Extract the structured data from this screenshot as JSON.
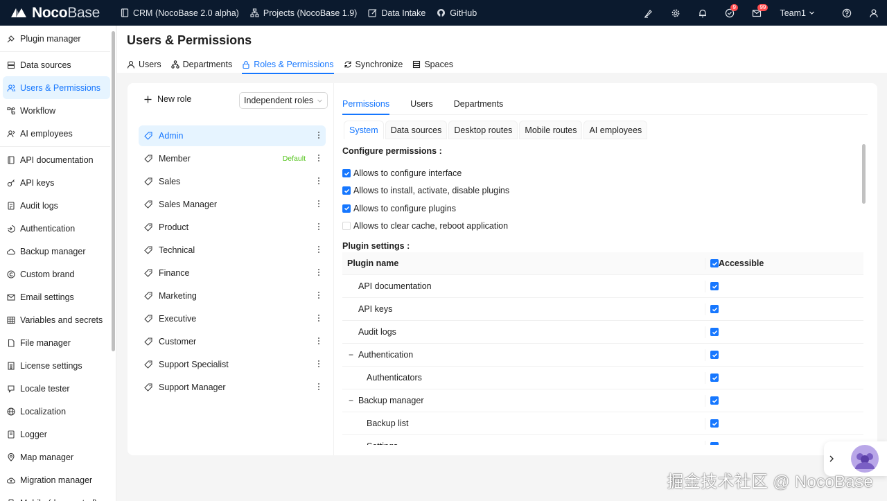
{
  "topbar": {
    "logo_bold": "Noco",
    "logo_thin": "Base",
    "nav": [
      {
        "label": "CRM (NocoBase 2.0 alpha)",
        "icon": "book-icon"
      },
      {
        "label": "Projects (NocoBase 1.9)",
        "icon": "sitemap-icon"
      },
      {
        "label": "Data Intake",
        "icon": "edit-icon"
      },
      {
        "label": "GitHub",
        "icon": "github-icon"
      }
    ],
    "right_icons": [
      "highlighter-icon",
      "gear-icon",
      "bell-icon",
      "check-circle-icon",
      "mail-icon"
    ],
    "badge_tasks": "9",
    "badge_mail": "99",
    "team": "Team1"
  },
  "sidebar": {
    "items": [
      {
        "label": "Plugin manager",
        "icon": "plug-icon"
      },
      {
        "label": "Data sources",
        "icon": "database-icon"
      },
      {
        "label": "Users & Permissions",
        "icon": "users-icon",
        "active": true
      },
      {
        "label": "Workflow",
        "icon": "workflow-icon"
      },
      {
        "label": "AI employees",
        "icon": "robot-user-icon"
      },
      {
        "label": "API documentation",
        "icon": "doc-icon"
      },
      {
        "label": "API keys",
        "icon": "key-icon"
      },
      {
        "label": "Audit logs",
        "icon": "audit-icon"
      },
      {
        "label": "Authentication",
        "icon": "login-icon"
      },
      {
        "label": "Backup manager",
        "icon": "cloud-icon"
      },
      {
        "label": "Custom brand",
        "icon": "copyright-icon"
      },
      {
        "label": "Email settings",
        "icon": "mail-icon"
      },
      {
        "label": "Variables and secrets",
        "icon": "table-icon"
      },
      {
        "label": "File manager",
        "icon": "file-icon"
      },
      {
        "label": "License settings",
        "icon": "license-icon"
      },
      {
        "label": "Locale tester",
        "icon": "locale-icon"
      },
      {
        "label": "Localization",
        "icon": "globe-icon"
      },
      {
        "label": "Logger",
        "icon": "logger-icon"
      },
      {
        "label": "Map manager",
        "icon": "pin-icon"
      },
      {
        "label": "Migration manager",
        "icon": "migration-icon"
      },
      {
        "label": "Mobile (deprecated)",
        "icon": "mobile-icon"
      }
    ]
  },
  "header": {
    "title": "Users & Permissions",
    "tabs": [
      {
        "label": "Users",
        "icon": "user-icon"
      },
      {
        "label": "Departments",
        "icon": "departments-icon"
      },
      {
        "label": "Roles & Permissions",
        "icon": "lock-icon",
        "active": true
      },
      {
        "label": "Synchronize",
        "icon": "sync-icon"
      },
      {
        "label": "Spaces",
        "icon": "spaces-icon"
      }
    ]
  },
  "roles_panel": {
    "new_role": "New role",
    "mode_select": "Independent roles",
    "default_tag": "Default",
    "roles": [
      "Admin",
      "Member",
      "Sales",
      "Sales Manager",
      "Product",
      "Technical",
      "Finance",
      "Marketing",
      "Executive",
      "Customer",
      "Support Specialist",
      "Support Manager"
    ]
  },
  "permissions": {
    "tabs": [
      "Permissions",
      "Users",
      "Departments"
    ],
    "sub_tabs": [
      "System",
      "Data sources",
      "Desktop routes",
      "Mobile routes",
      "AI employees"
    ],
    "configure_title": "Configure permissions",
    "configure_items": [
      {
        "label": "Allows to configure interface",
        "checked": true
      },
      {
        "label": "Allows to install, activate, disable plugins",
        "checked": true
      },
      {
        "label": "Allows to configure plugins",
        "checked": true
      },
      {
        "label": "Allows to clear cache, reboot application",
        "checked": false
      }
    ],
    "plugin_settings_title": "Plugin settings",
    "col_name": "Plugin name",
    "col_accessible": "Accessible",
    "rows": [
      {
        "name": "API documentation",
        "level": 0,
        "expand": "",
        "checked": true
      },
      {
        "name": "API keys",
        "level": 0,
        "expand": "",
        "checked": true
      },
      {
        "name": "Audit logs",
        "level": 0,
        "expand": "",
        "checked": true
      },
      {
        "name": "Authentication",
        "level": 0,
        "expand": "−",
        "checked": true
      },
      {
        "name": "Authenticators",
        "level": 1,
        "expand": "",
        "checked": true
      },
      {
        "name": "Backup manager",
        "level": 0,
        "expand": "−",
        "checked": true
      },
      {
        "name": "Backup list",
        "level": 1,
        "expand": "",
        "checked": true
      },
      {
        "name": "Settings",
        "level": 1,
        "expand": "",
        "checked": true
      }
    ]
  },
  "watermark": "掘金技术社区 @ NocoBase"
}
